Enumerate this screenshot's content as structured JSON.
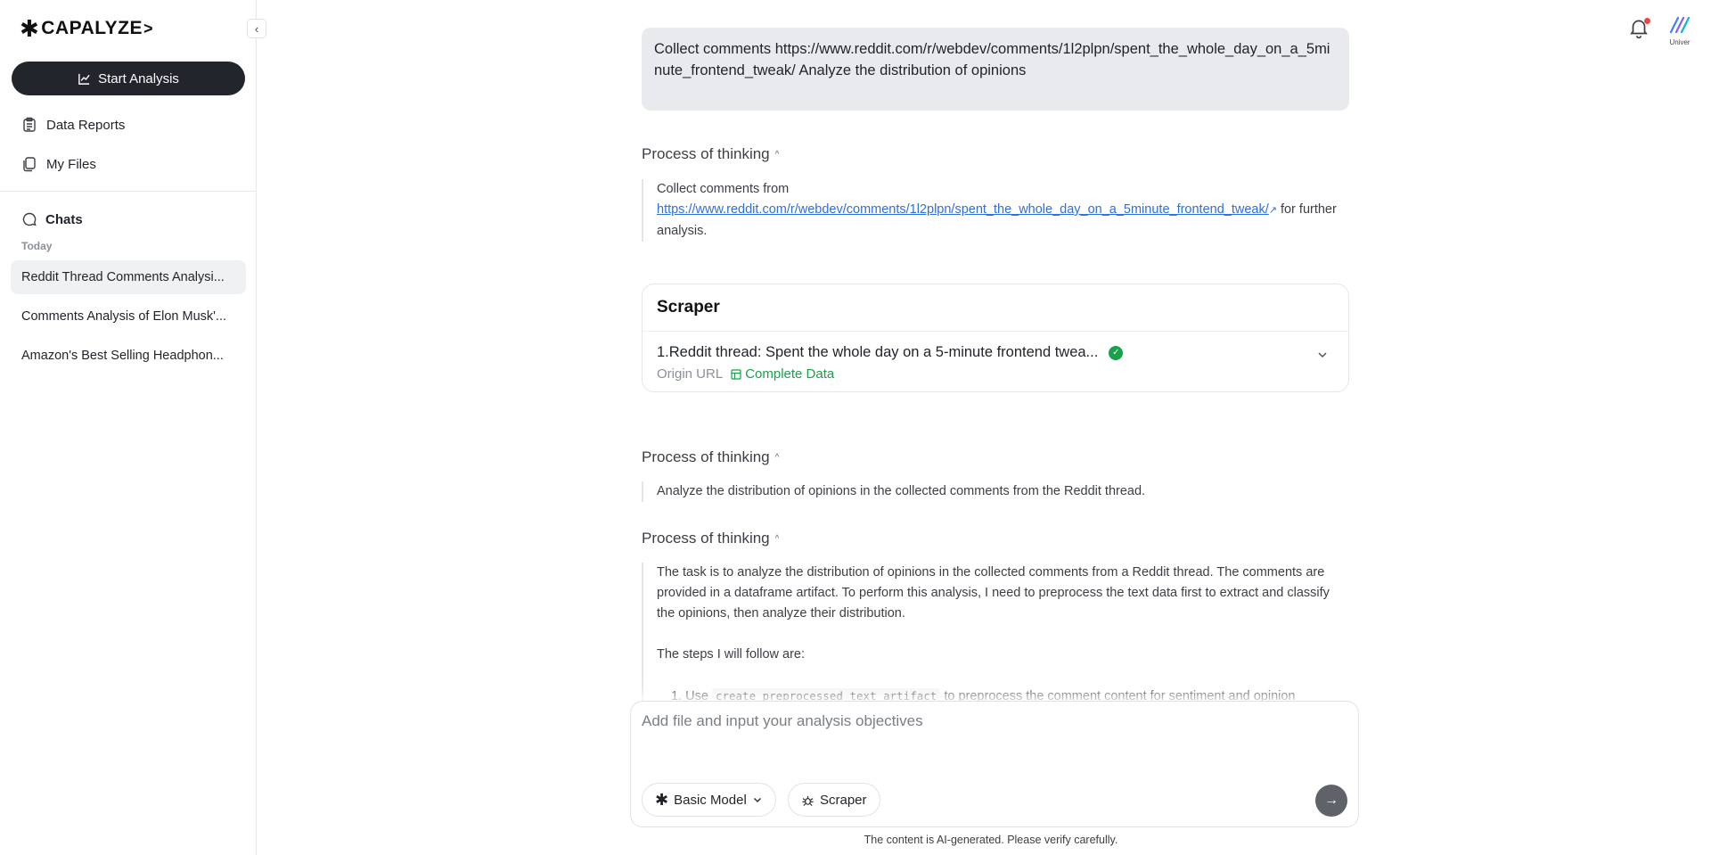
{
  "sidebar": {
    "logo": "CAPALYZE",
    "start_button": "Start Analysis",
    "nav": [
      {
        "label": "Data Reports",
        "icon": "clipboard-icon"
      },
      {
        "label": "My Files",
        "icon": "files-icon"
      }
    ],
    "chats_label": "Chats",
    "today_label": "Today",
    "chats": [
      {
        "label": "Reddit Thread Comments Analysi...",
        "active": true
      },
      {
        "label": "Comments Analysis of Elon Musk'...",
        "active": false
      },
      {
        "label": "Amazon's Best Selling Headphon...",
        "active": false
      }
    ]
  },
  "header": {
    "brand_label": "Univer"
  },
  "conversation": {
    "user_message": "Collect comments https://www.reddit.com/r/webdev/comments/1l2plpn/spent_the_whole_day_on_a_5minute_frontend_tweak/ Analyze the distribution of opinions",
    "thinking_1": {
      "title": "Process of thinking",
      "prefix": "Collect comments from",
      "link": "https://www.reddit.com/r/webdev/comments/1l2plpn/spent_the_whole_day_on_a_5minute_frontend_tweak/",
      "suffix": "for further analysis."
    },
    "scraper": {
      "title": "Scraper",
      "item_title": "1.Reddit thread: Spent the whole day on a 5-minute frontend twea...",
      "origin_label": "Origin URL",
      "complete_label": "Complete Data"
    },
    "thinking_2": {
      "title": "Process of thinking",
      "text": "Analyze the distribution of opinions in the collected comments from the Reddit thread."
    },
    "thinking_3": {
      "title": "Process of thinking",
      "paragraph": "The task is to analyze the distribution of opinions in the collected comments from a Reddit thread. The comments are provided in a dataframe artifact. To perform this analysis, I need to preprocess the text data first to extract and classify the opinions, then analyze their distribution.",
      "steps_intro": "The steps I will follow are:",
      "step_1_prefix": "1. Use",
      "step_1_code": "create_preprocessed_text_artifact",
      "step_1_suffix": "to preprocess the comment content for sentiment and opinion"
    }
  },
  "composer": {
    "placeholder": "Add file and input your analysis objectives",
    "model_label": "Basic Model",
    "scraper_label": "Scraper"
  },
  "footer": {
    "disclaimer": "The content is AI-generated. Please verify carefully."
  }
}
